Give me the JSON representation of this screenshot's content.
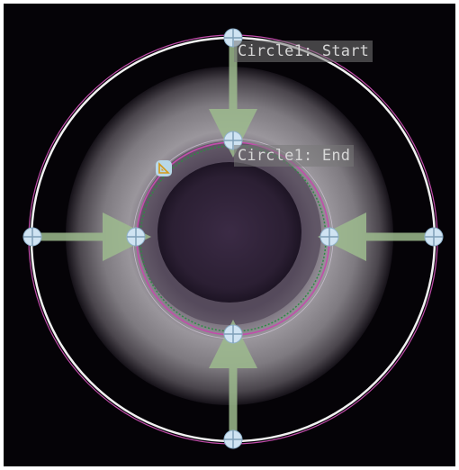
{
  "overlay": {
    "start_label": "Circle1: Start",
    "end_label": "Circle1: End"
  },
  "icons": {
    "handle": "circle-handle-icon",
    "arrow": "direction-arrow-icon",
    "tool": "set-square-icon"
  },
  "colors": {
    "outer_circle": "#f2f2f2",
    "magenta_circle": "#c24dab",
    "green_circle": "#2f8a45",
    "arrow": "#9dbb8e",
    "handle": "#cfe3f2",
    "label_bg": "#7a7a7a",
    "label_text": "#d6d6d6"
  }
}
